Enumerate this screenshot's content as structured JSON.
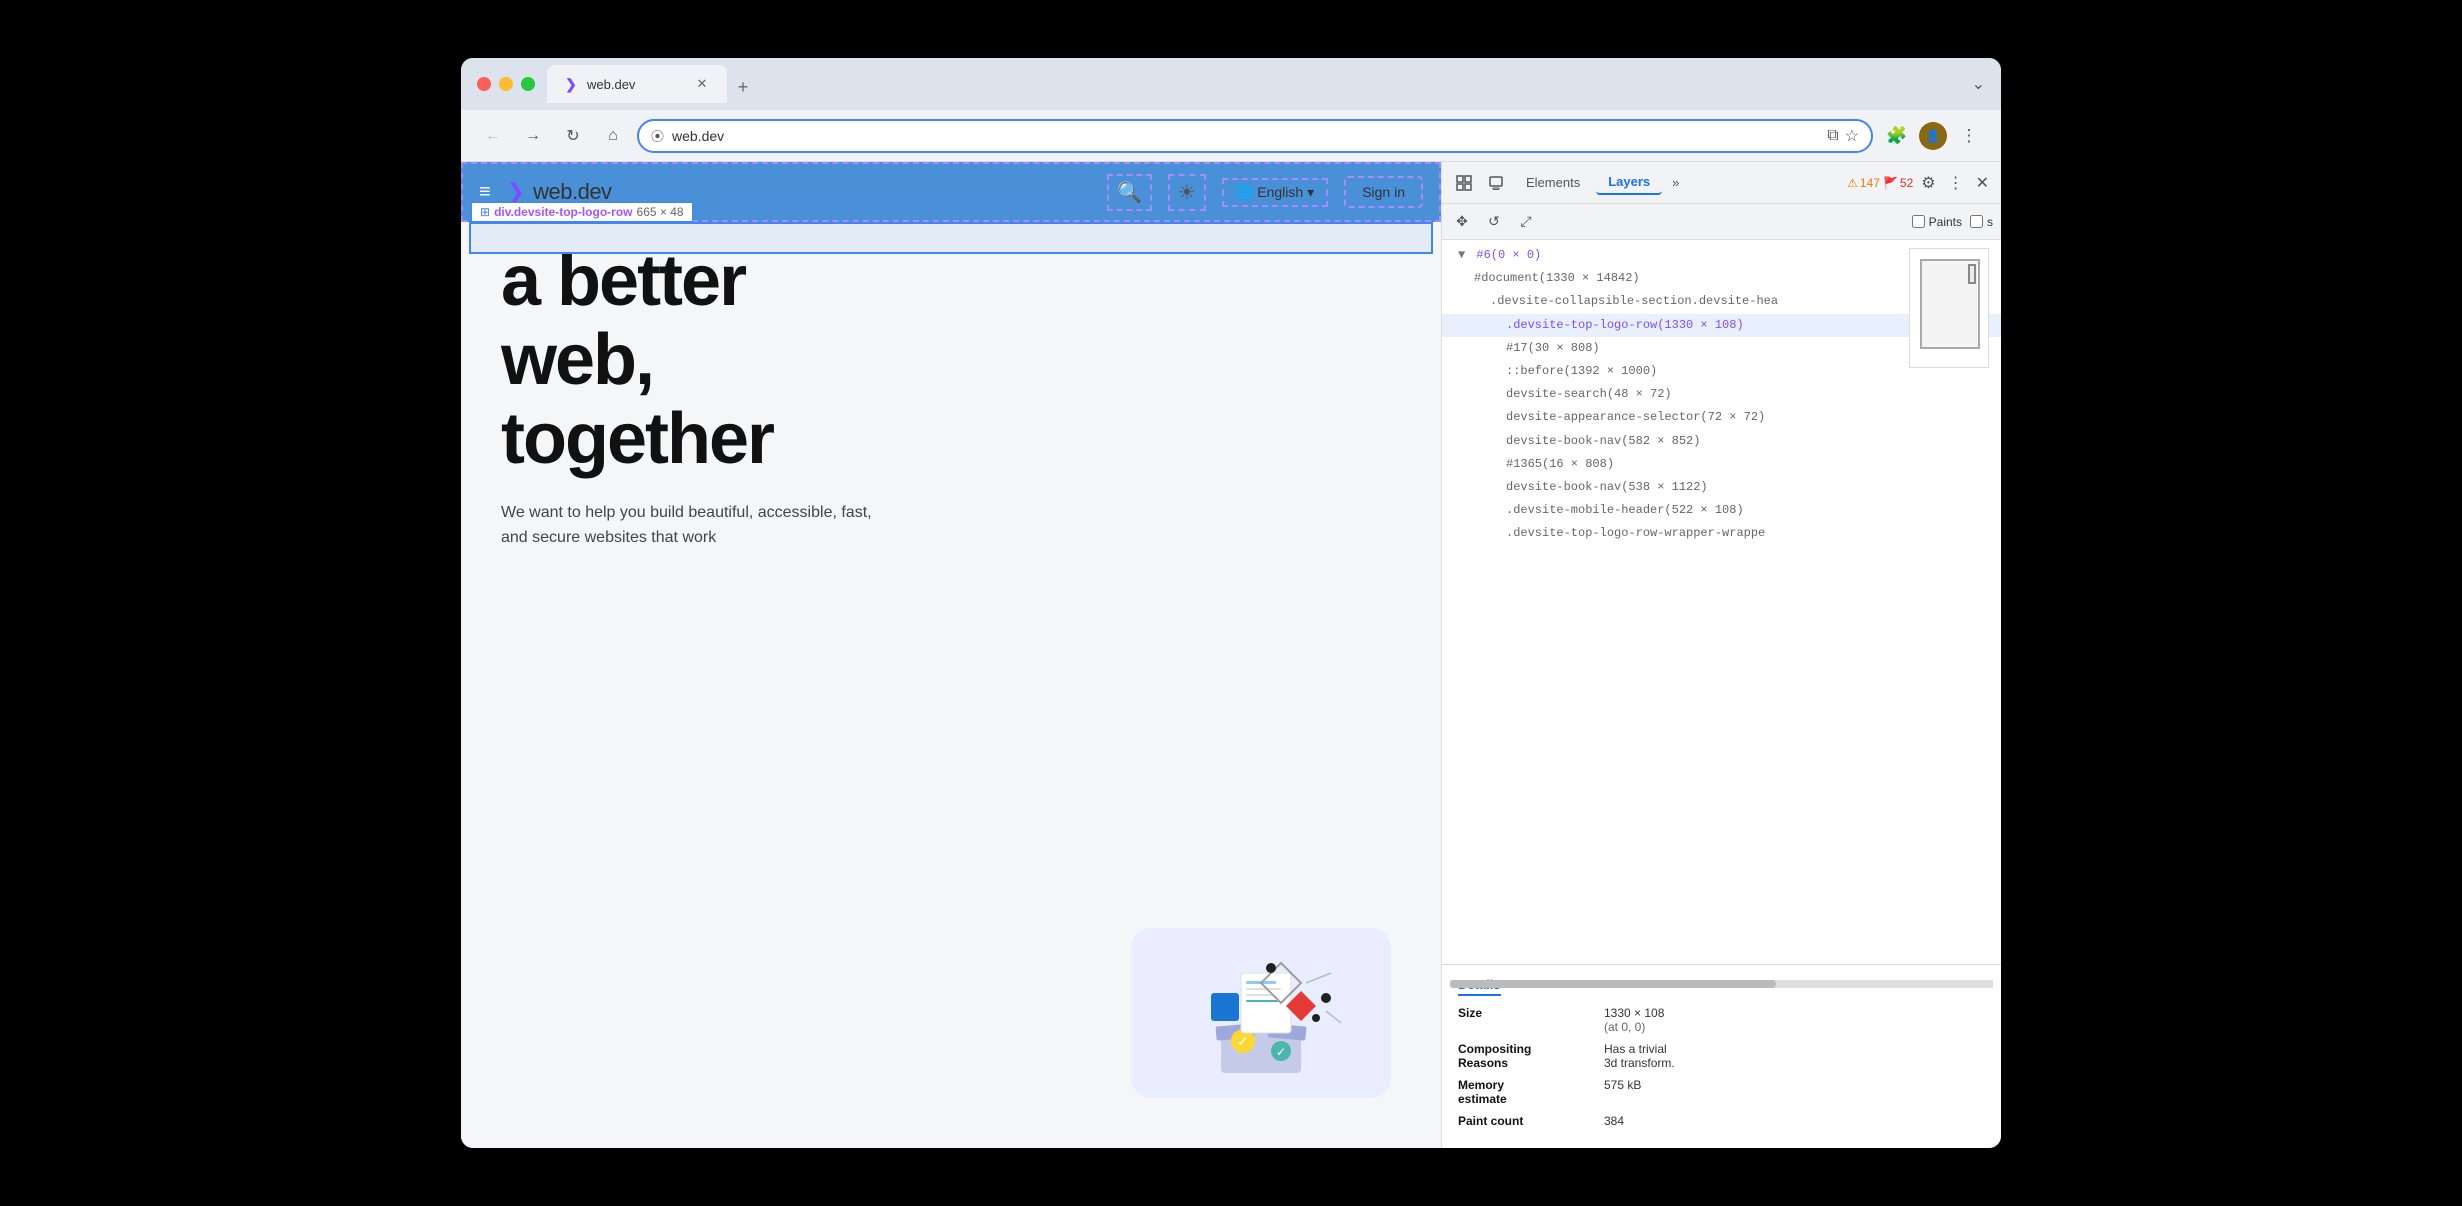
{
  "browser": {
    "traffic_lights": [
      "red",
      "yellow",
      "green"
    ],
    "tab": {
      "favicon": "❯",
      "title": "web.dev",
      "close_btn": "✕"
    },
    "new_tab_btn": "+",
    "dropdown_arrow": "⌄"
  },
  "navbar": {
    "back_btn": "←",
    "forward_btn": "→",
    "reload_btn": "↻",
    "home_btn": "⌂",
    "address_icon": "⦿",
    "url": "web.dev",
    "open_external_icon": "⧉",
    "bookmark_icon": "☆",
    "extensions_icon": "🧩",
    "more_icon": "⋮"
  },
  "webpage": {
    "header": {
      "hamburger": "≡",
      "logo_icon": "❯",
      "logo_text": "web.dev",
      "search_icon": "🔍",
      "brightness_icon": "☀",
      "globe_icon": "🌐",
      "language": "English",
      "dropdown_icon": "▾",
      "signin": "Sign in"
    },
    "element_highlight": {
      "icon": "⊞",
      "name": "div.devsite-top-logo-row",
      "size": "665 × 48"
    },
    "heading_line1": "a better",
    "heading_line2": "web,",
    "heading_line3": "together",
    "subtext": "We want to help you build beautiful, accessible, fast, and secure websites that work"
  },
  "devtools": {
    "tabs": [
      {
        "label": "Elements",
        "active": false
      },
      {
        "label": "Layers",
        "active": true
      }
    ],
    "more_tabs": "»",
    "warnings": "147",
    "errors": "52",
    "settings_icon": "⚙",
    "more_icon": "⋮",
    "close_icon": "✕",
    "secondary": {
      "move_icon": "✥",
      "rotate_icon": "↺",
      "resize_icon": "⤢",
      "paints_label": "Paints",
      "scroll_label": "s"
    },
    "tree": {
      "root": "#6(0 × 0)",
      "items": [
        {
          "level": 1,
          "text": "#document(1330 × 14842)",
          "selected": false
        },
        {
          "level": 2,
          "text": ".devsite-collapsible-section.devsite-hea",
          "selected": false
        },
        {
          "level": 3,
          "text": ".devsite-top-logo-row(1330 × 108)",
          "selected": true
        },
        {
          "level": 3,
          "text": "#17(30 × 808)",
          "selected": false
        },
        {
          "level": 3,
          "text": "::before(1392 × 1000)",
          "selected": false
        },
        {
          "level": 3,
          "text": "devsite-search(48 × 72)",
          "selected": false
        },
        {
          "level": 3,
          "text": "devsite-appearance-selector(72 × 72)",
          "selected": false
        },
        {
          "level": 3,
          "text": "devsite-book-nav(582 × 852)",
          "selected": false
        },
        {
          "level": 3,
          "text": "#1365(16 × 808)",
          "selected": false
        },
        {
          "level": 3,
          "text": "devsite-book-nav(538 × 1122)",
          "selected": false
        },
        {
          "level": 3,
          "text": ".devsite-mobile-header(522 × 108)",
          "selected": false
        },
        {
          "level": 3,
          "text": ".devsite-top-logo-row-wrapper-wrappe",
          "selected": false
        }
      ]
    },
    "details": {
      "header": "Details",
      "size_label": "Size",
      "size_value": "1330 × 108",
      "size_sub": "(at 0, 0)",
      "compositing_label": "Compositing\nReasons",
      "compositing_value": "Has a trivial\n3d transform.",
      "memory_label": "Memory\nestimate",
      "memory_value": "575 kB",
      "paint_label": "Paint count",
      "paint_value": "384"
    }
  }
}
